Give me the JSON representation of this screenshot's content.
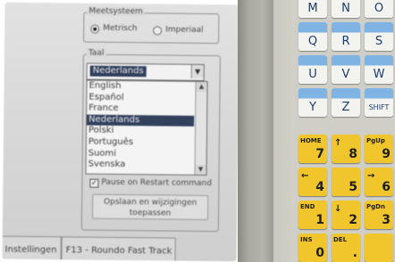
{
  "screen": {
    "groups": {
      "units_label": "Meetsysteem",
      "language_label": "Taal"
    },
    "units_options": [
      {
        "label": "Metrisch",
        "selected": true
      },
      {
        "label": "Imperiaal",
        "selected": false
      }
    ],
    "language_combo": {
      "value": "Nederlands"
    },
    "language_list": [
      "English",
      "Español",
      "France",
      "Nederlands",
      "Polski",
      "Português",
      "Suomi",
      "Svenska"
    ],
    "selected_language": "Nederlands",
    "pause_checkbox": {
      "label": "Pause on Restart command",
      "checked": true
    },
    "save_button": {
      "line1": "Opslaan en wijzigingen",
      "line2": "toepassen"
    },
    "tabs": [
      {
        "label": "Instellingen"
      },
      {
        "label": "F13 - Roundo Fast Track"
      }
    ]
  },
  "keypad": {
    "letter_keys": [
      "M",
      "N",
      "O",
      "Q",
      "R",
      "S",
      "U",
      "V",
      "W",
      "Y",
      "Z",
      "SHIFT"
    ],
    "nav_keys": [
      {
        "top": "HOME",
        "num": "7"
      },
      {
        "top": "↑",
        "num": "8"
      },
      {
        "top": "PgUp",
        "num": "9"
      },
      {
        "top": "←",
        "num": "4"
      },
      {
        "top": "",
        "num": "5"
      },
      {
        "top": "→",
        "num": "6"
      },
      {
        "top": "END",
        "num": "1"
      },
      {
        "top": "↓",
        "num": "2"
      },
      {
        "top": "PgDn",
        "num": "3"
      },
      {
        "top": "INS",
        "num": "0"
      },
      {
        "top": "DEL",
        "num": "."
      },
      {
        "top": "",
        "num": ""
      }
    ]
  },
  "colors": {
    "screen_bg": "#d9d9d9",
    "selection": "#32405e",
    "key_blue": "#7fb3e4",
    "key_yellow": "#f0c62c"
  }
}
